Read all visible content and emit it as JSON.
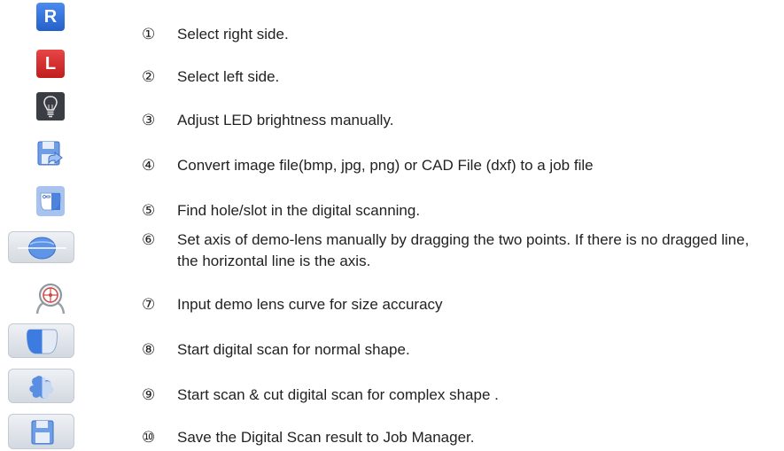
{
  "items": [
    {
      "num": "①",
      "icon": "right-side-icon",
      "icon_text": "R",
      "desc": "Select right side."
    },
    {
      "num": "②",
      "icon": "left-side-icon",
      "icon_text": "L",
      "desc": "Select left side."
    },
    {
      "num": "③",
      "icon": "led-brightness-icon",
      "desc": "Adjust LED brightness manually."
    },
    {
      "num": "④",
      "icon": "convert-file-icon",
      "desc": "Convert image file(bmp, jpg, png) or CAD File (dxf) to a job file"
    },
    {
      "num": "⑤",
      "icon": "find-hole-icon",
      "desc": "Find hole/slot in the digital scanning."
    },
    {
      "num": "⑥",
      "icon": "set-axis-icon",
      "desc": "Set axis of demo-lens manually by dragging the two points. If there is no dragged line, the horizontal line is the axis."
    },
    {
      "num": "⑦",
      "icon": "lens-curve-icon",
      "desc": "Input demo lens curve for size accuracy"
    },
    {
      "num": "⑧",
      "icon": "normal-scan-icon",
      "desc": "Start digital scan for normal shape."
    },
    {
      "num": "⑨",
      "icon": "complex-scan-icon",
      "desc": "Start scan & cut digital scan for complex shape ."
    },
    {
      "num": "⑩",
      "icon": "save-job-icon",
      "desc": "Save the Digital Scan result to Job Manager."
    }
  ],
  "colors": {
    "right_blue": "#2f6fd6",
    "left_red": "#d42a2a",
    "dark_gray": "#3a3d44",
    "tile_blue": "#a9c3ef",
    "button_gray": "#dfe3e8"
  }
}
